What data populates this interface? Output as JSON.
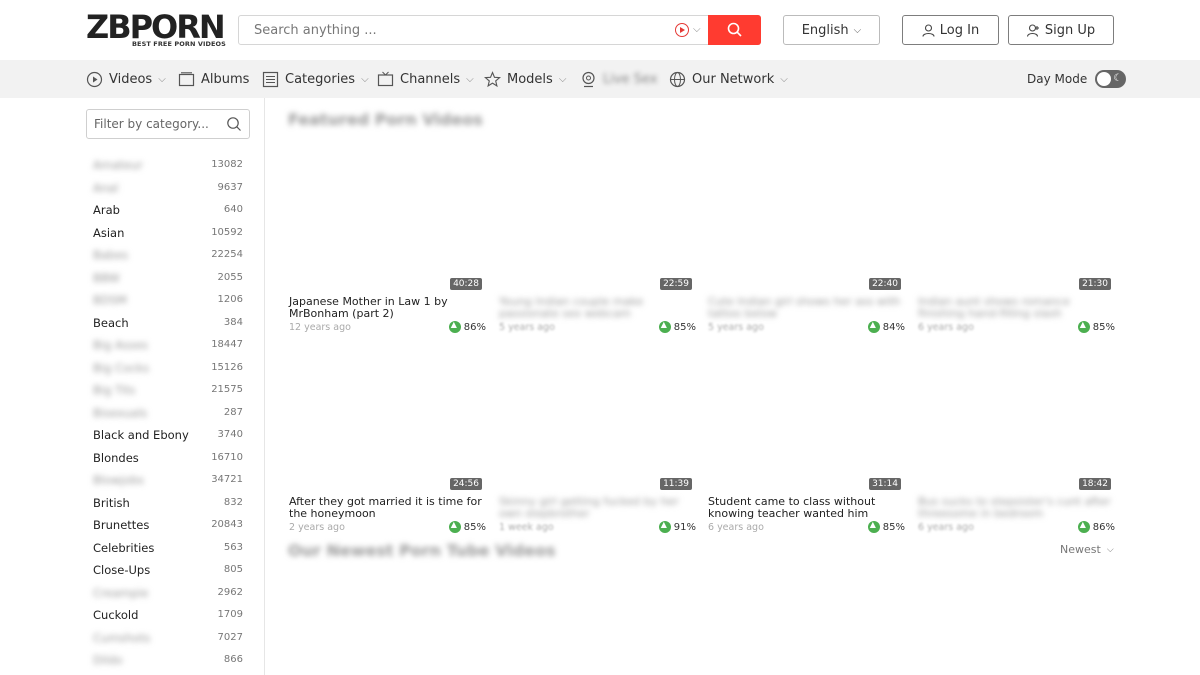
{
  "header": {
    "logo_text": "ZBPORN",
    "logo_tagline": "BEST FREE PORN VIDEOS",
    "search_placeholder": "Search anything ...",
    "language": "English",
    "login": "Log In",
    "signup": "Sign Up",
    "accent_color": "#ff3b30"
  },
  "nav": {
    "items": [
      {
        "label": "Videos",
        "icon": "play-circle-icon",
        "dropdown": true
      },
      {
        "label": "Albums",
        "icon": "album-icon",
        "dropdown": false
      },
      {
        "label": "Categories",
        "icon": "list-icon",
        "dropdown": true
      },
      {
        "label": "Channels",
        "icon": "tv-icon",
        "dropdown": true
      },
      {
        "label": "Models",
        "icon": "star-icon",
        "dropdown": true
      },
      {
        "label": "Live Sex",
        "icon": "webcam-icon",
        "dropdown": false
      },
      {
        "label": "Our Network",
        "icon": "globe-icon",
        "dropdown": true
      }
    ],
    "day_mode": "Day Mode"
  },
  "sidebar": {
    "filter_placeholder": "Filter by category...",
    "categories": [
      {
        "name": "Amateur",
        "count": "13082",
        "blurred": true
      },
      {
        "name": "Anal",
        "count": "9637",
        "blurred": true
      },
      {
        "name": "Arab",
        "count": "640",
        "blurred": false
      },
      {
        "name": "Asian",
        "count": "10592",
        "blurred": false
      },
      {
        "name": "Babes",
        "count": "22254",
        "blurred": true
      },
      {
        "name": "BBW",
        "count": "2055",
        "blurred": true
      },
      {
        "name": "BDSM",
        "count": "1206",
        "blurred": true
      },
      {
        "name": "Beach",
        "count": "384",
        "blurred": false
      },
      {
        "name": "Big Asses",
        "count": "18447",
        "blurred": true
      },
      {
        "name": "Big Cocks",
        "count": "15126",
        "blurred": true
      },
      {
        "name": "Big Tits",
        "count": "21575",
        "blurred": true
      },
      {
        "name": "Bisexuals",
        "count": "287",
        "blurred": true
      },
      {
        "name": "Black and Ebony",
        "count": "3740",
        "blurred": false
      },
      {
        "name": "Blondes",
        "count": "16710",
        "blurred": false
      },
      {
        "name": "Blowjobs",
        "count": "34721",
        "blurred": true
      },
      {
        "name": "British",
        "count": "832",
        "blurred": false
      },
      {
        "name": "Brunettes",
        "count": "20843",
        "blurred": false
      },
      {
        "name": "Celebrities",
        "count": "563",
        "blurred": false
      },
      {
        "name": "Close-Ups",
        "count": "805",
        "blurred": false
      },
      {
        "name": "Creampie",
        "count": "2962",
        "blurred": true
      },
      {
        "name": "Cuckold",
        "count": "1709",
        "blurred": false
      },
      {
        "name": "Cumshots",
        "count": "7027",
        "blurred": true
      },
      {
        "name": "Dildo",
        "count": "866",
        "blurred": true
      }
    ]
  },
  "featured": {
    "title": "Featured Porn Videos",
    "videos": [
      {
        "duration": "40:28",
        "title": "Japanese Mother in Law 1 by MrBonham (part 2)",
        "ago": "12 years ago",
        "rating": "86%",
        "blurred": false
      },
      {
        "duration": "22:59",
        "title": "Young Indian couple make passionate sex webcam",
        "ago": "5 years ago",
        "rating": "85%",
        "blurred": true
      },
      {
        "duration": "22:40",
        "title": "Cute Indian girl shows her ass with tattoo below",
        "ago": "5 years ago",
        "rating": "84%",
        "blurred": true
      },
      {
        "duration": "21:30",
        "title": "Indian aunt shows romance finishing hand-filling slash",
        "ago": "6 years ago",
        "rating": "85%",
        "blurred": true
      },
      {
        "duration": "24:56",
        "title": "After they got married it is time for the honeymoon",
        "ago": "2 years ago",
        "rating": "85%",
        "blurred": false
      },
      {
        "duration": "11:39",
        "title": "Skinny girl getting fucked by her own stepbrother",
        "ago": "1 week ago",
        "rating": "91%",
        "blurred": true
      },
      {
        "duration": "31:14",
        "title": "Student came to class without knowing teacher wanted him",
        "ago": "6 years ago",
        "rating": "85%",
        "blurred": false
      },
      {
        "duration": "18:42",
        "title": "Bus sucks to stepsister's cunt after threesome in bedroom",
        "ago": "6 years ago",
        "rating": "86%",
        "blurred": true
      }
    ]
  },
  "newest": {
    "title": "Our Newest Porn Tube Videos",
    "sort": "Newest"
  }
}
